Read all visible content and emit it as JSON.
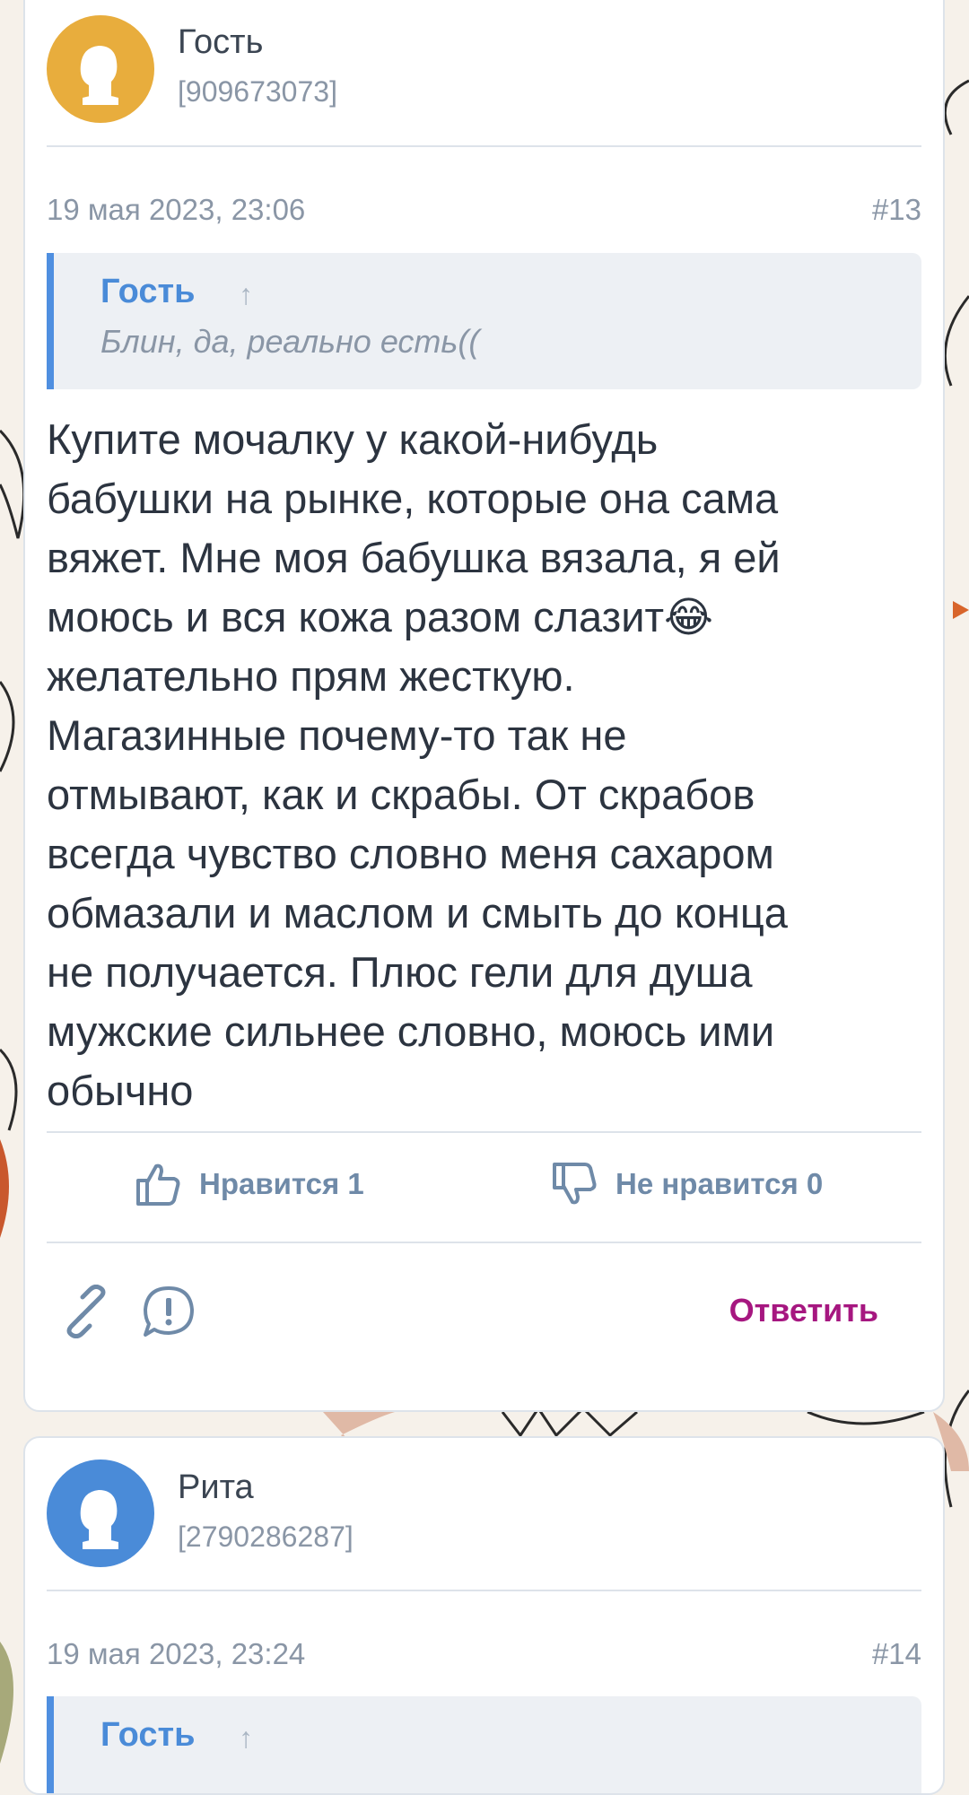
{
  "colors": {
    "accent_blue": "#4a8bd8",
    "reply_magenta": "#a61780",
    "avatar_guest": "#e8ad3d",
    "avatar_rita": "#4a8bd8"
  },
  "posts": [
    {
      "author": "Гость",
      "author_id": "[909673073]",
      "date": "19 мая 2023, 23:06",
      "number": "#13",
      "quote": {
        "author": "Гость",
        "arrow": "↑",
        "text": "Блин, да, реально есть(("
      },
      "body": "Купите мочалку у какой-нибудь\nбабушки на рынке, которые она сама\nвяжет. Мне моя бабушка вязала, я ей\nмоюсь и вся кожа разом слазит😂\nжелательно прям жесткую.\nМагазинные почему-то так не\nотмывают, как и скрабы. От скрабов\nвсегда чувство словно меня сахаром\nобмазали и маслом и смыть до конца\nне получается. Плюс гели для душа\nмужские сильнее словно, моюсь ими\nобычно",
      "like_label": "Нравится 1",
      "dislike_label": "Не нравится 0",
      "reply_label": "Ответить",
      "icons": [
        "link-icon",
        "report-icon",
        "thumbs-up-icon",
        "thumbs-down-icon",
        "arrow-up-icon"
      ]
    },
    {
      "author": "Рита",
      "author_id": "[2790286287]",
      "date": "19 мая 2023, 23:24",
      "number": "#14",
      "quote": {
        "author": "Гость",
        "arrow": "↑"
      }
    }
  ]
}
